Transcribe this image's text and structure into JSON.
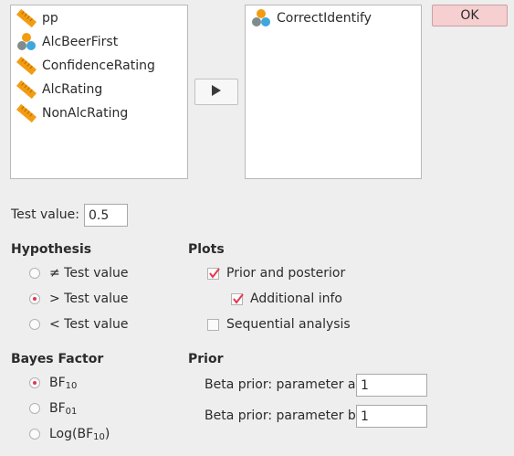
{
  "available_variables": [
    {
      "label": "pp",
      "type": "scale",
      "icon": "ruler-scale-icon"
    },
    {
      "label": "AlcBeerFirst",
      "type": "nominal",
      "icon": "nominal-circles-icon"
    },
    {
      "label": "ConfidenceRating",
      "type": "scale",
      "icon": "ruler-scale-icon"
    },
    {
      "label": "AlcRating",
      "type": "scale",
      "icon": "ruler-scale-icon"
    },
    {
      "label": "NonAlcRating",
      "type": "scale",
      "icon": "ruler-scale-icon"
    }
  ],
  "assigned_variables": [
    {
      "label": "CorrectIdentify",
      "type": "nominal",
      "icon": "nominal-circles-icon"
    }
  ],
  "ok_button": {
    "label": "OK"
  },
  "move_button": {
    "icon": "play-arrow-icon"
  },
  "test_value": {
    "label": "Test value:",
    "value": "0.5"
  },
  "hypothesis": {
    "title": "Hypothesis",
    "options": [
      {
        "label": "≠ Test value",
        "selected": false
      },
      {
        "label": "> Test value",
        "selected": true
      },
      {
        "label": "< Test value",
        "selected": false
      }
    ]
  },
  "plots": {
    "title": "Plots",
    "options": [
      {
        "label": "Prior and posterior",
        "checked": true
      },
      {
        "label": "Additional info",
        "checked": true
      },
      {
        "label": "Sequential analysis",
        "checked": false
      }
    ]
  },
  "bayes_factor": {
    "title": "Bayes Factor",
    "options": [
      {
        "label": "BF",
        "sub": "10",
        "selected": true
      },
      {
        "label": "BF",
        "sub": "01",
        "selected": false
      },
      {
        "label": "Log(BF",
        "sub": "10",
        "suffix": ")",
        "selected": false
      }
    ]
  },
  "prior": {
    "title": "Prior",
    "param_a": {
      "label": "Beta prior: parameter a",
      "value": "1"
    },
    "param_b": {
      "label": "Beta prior: parameter b",
      "value": "1"
    }
  },
  "colors": {
    "accent": "#e4374f",
    "ok_bg": "#f6cfd0",
    "scale_icon": "#f39c12",
    "nominal_orange": "#f39c12",
    "nominal_blue": "#3da7de",
    "nominal_gray": "#7f8c8d"
  }
}
